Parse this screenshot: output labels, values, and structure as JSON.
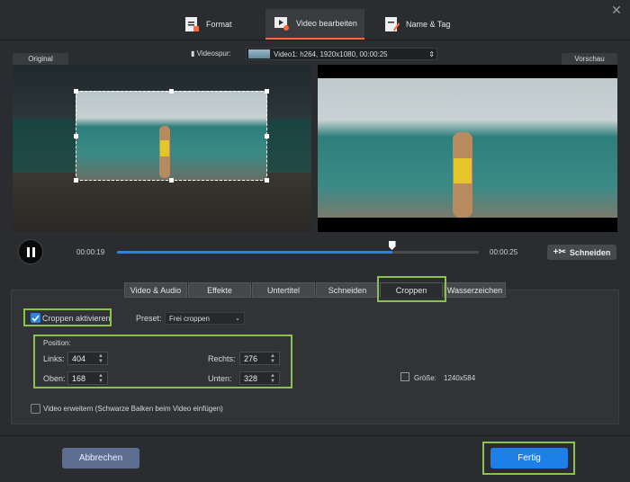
{
  "window": {
    "close_icon": "close-icon"
  },
  "top_tabs": [
    {
      "label": "Format",
      "icon": "format-icon",
      "active": false
    },
    {
      "label": "Video bearbeiten",
      "icon": "video-edit-icon",
      "active": true
    },
    {
      "label": "Name & Tag",
      "icon": "name-tag-icon",
      "active": false
    }
  ],
  "track": {
    "label": "Videospur:",
    "value": "Video1: h264, 1920x1080, 00:00:25"
  },
  "panels": {
    "original": "Original",
    "preview": "Vorschau"
  },
  "playback": {
    "current": "00:00:19",
    "total": "00:00:25",
    "progress_fraction": 0.76,
    "cut_label": "Schneiden"
  },
  "edit_tabs": [
    {
      "label": "Video & Audio",
      "active": false
    },
    {
      "label": "Effekte",
      "active": false
    },
    {
      "label": "Untertitel",
      "active": false
    },
    {
      "label": "Schneiden",
      "active": false
    },
    {
      "label": "Croppen",
      "active": true
    },
    {
      "label": "Wasserzeichen",
      "active": false
    }
  ],
  "crop": {
    "enable_label": "Croppen aktivieren",
    "enabled": true,
    "preset_label": "Preset:",
    "preset_value": "Frei croppen",
    "position_label": "Position:",
    "left_label": "Links:",
    "left_value": "404",
    "top_label": "Oben:",
    "top_value": "168",
    "right_label": "Rechts:",
    "right_value": "276",
    "bottom_label": "Unten:",
    "bottom_value": "328",
    "size_label": "Größe:",
    "size_value": "1240x584",
    "expand_label": "Video erweitern (Schwarze Balken beim Video einfügen)",
    "expand_enabled": false
  },
  "footer": {
    "cancel_label": "Abbrechen",
    "done_label": "Fertig"
  },
  "colors": {
    "accent": "#2e82e6",
    "highlight": "#8bc34a",
    "tab_underline": "#ff6a3a"
  }
}
